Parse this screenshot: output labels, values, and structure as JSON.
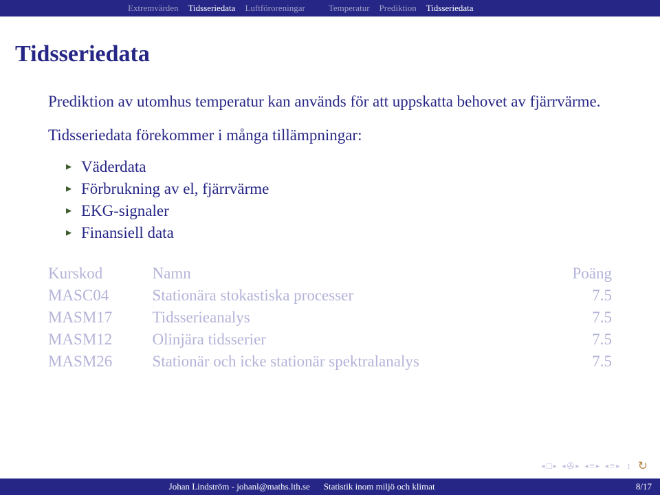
{
  "nav": {
    "left": [
      {
        "label": "Extremvärden",
        "active": false
      },
      {
        "label": "Tidsseriedata",
        "active": true
      },
      {
        "label": "Luftföroreningar",
        "active": false
      }
    ],
    "right": [
      {
        "label": "Temperatur",
        "active": false
      },
      {
        "label": "Prediktion",
        "active": false
      },
      {
        "label": "Tidsseriedata",
        "active": true
      }
    ]
  },
  "title": "Tidsseriedata",
  "para1": "Prediktion av utomhus temperatur kan används för att uppskatta behovet av fjärrvärme.",
  "para2": "Tidsseriedata förekommer i många tillämpningar:",
  "bullets": [
    "Väderdata",
    "Förbrukning av el, fjärrvärme",
    "EKG-signaler",
    "Finansiell data"
  ],
  "courses": {
    "head": {
      "code": "Kurskod",
      "name": "Namn",
      "pts": "Poäng"
    },
    "rows": [
      {
        "code": "MASC04",
        "name": "Stationära stokastiska processer",
        "pts": "7.5"
      },
      {
        "code": "MASM17",
        "name": "Tidsserieanalys",
        "pts": "7.5"
      },
      {
        "code": "MASM12",
        "name": "Olinjära tidsserier",
        "pts": "7.5"
      },
      {
        "code": "MASM26",
        "name": "Stationär och icke stationär spektralanalys",
        "pts": "7.5"
      }
    ]
  },
  "footer": {
    "left": "Johan Lindström - johanl@maths.lth.se",
    "center": "Statistik inom miljö och klimat",
    "right": "8/17"
  }
}
